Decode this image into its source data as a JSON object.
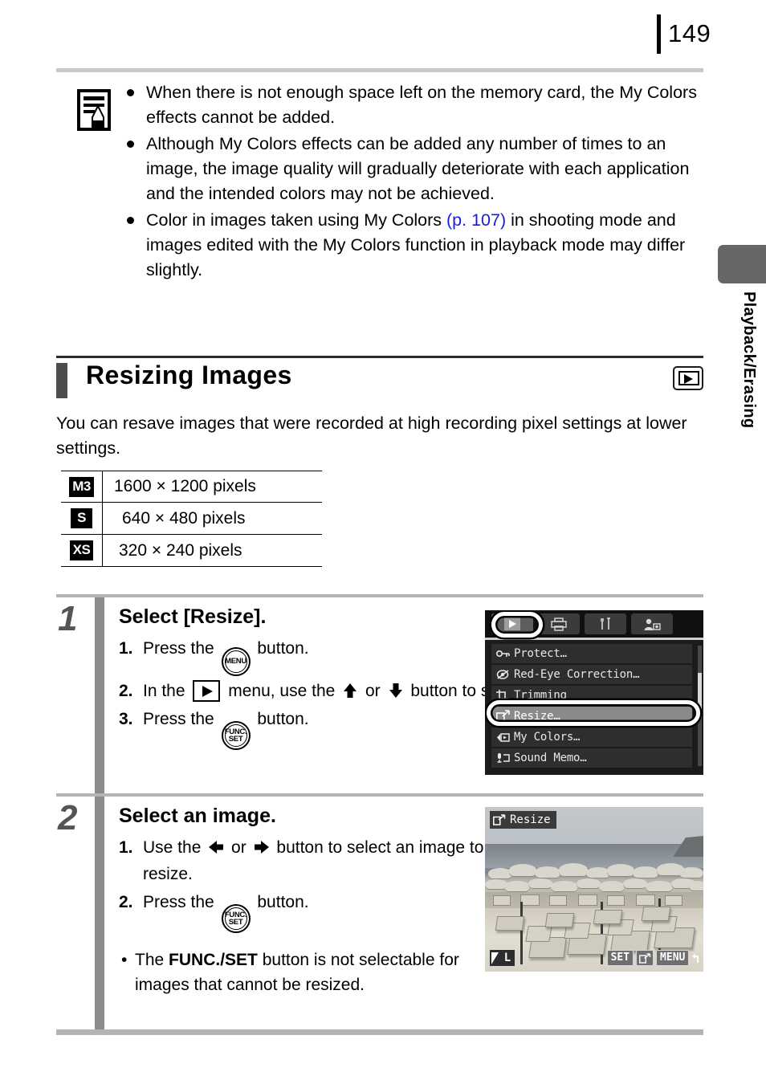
{
  "page": {
    "number": "149",
    "side_tab_label": "Playback/Erasing"
  },
  "note": {
    "icon": "memo-note-icon",
    "items": [
      {
        "text_before": "When there is not enough space left on the memory card, the My Colors effects cannot be added.",
        "xref": "",
        "text_after": ""
      },
      {
        "text_before": "Although My Colors effects can be added any number of times to an image, the image quality will gradually deteriorate with each application and the intended colors may not be achieved.",
        "xref": "",
        "text_after": ""
      },
      {
        "text_before": "Color in images taken using My Colors ",
        "xref": "(p. 107)",
        "text_after": " in shooting mode and images edited with the My Colors function in playback mode may differ slightly."
      }
    ],
    "xref_color": "#1a1ae0"
  },
  "section": {
    "title": "Resizing Images",
    "badge_icon": "playback-mode-icon",
    "description": "You can resave images that were recorded at high recording pixel settings at lower settings."
  },
  "size_table": {
    "rows": [
      {
        "badge": "M3",
        "label": "1600 × 1200 pixels"
      },
      {
        "badge": "S",
        "label": "640 × 480 pixels"
      },
      {
        "badge": "XS",
        "label": "320 × 240 pixels"
      }
    ]
  },
  "steps": [
    {
      "number": "1",
      "title": "Select [Resize].",
      "substeps": [
        {
          "num": "1.",
          "a": "Press the ",
          "icon": "menu-button-icon",
          "b": " button.",
          "c": "",
          "icon2": "",
          "d": ""
        },
        {
          "num": "2.",
          "a": "In the ",
          "icon": "playback-mode-icon",
          "b": " menu, use the ",
          "arrows": "up-down",
          "c": " button to select ",
          "icon2": "resize-icon",
          "d": "."
        },
        {
          "num": "3.",
          "a": "Press the ",
          "icon": "func-set-button-icon",
          "b": " button.",
          "c": "",
          "icon2": "",
          "d": ""
        }
      ],
      "notes": []
    },
    {
      "number": "2",
      "title": "Select an image.",
      "substeps": [
        {
          "num": "1.",
          "a": "Use the ",
          "arrows": "left-right",
          "b": " button to select an image to resize.",
          "c": "",
          "icon2": "",
          "d": ""
        },
        {
          "num": "2.",
          "a": "Press the ",
          "icon": "func-set-button-icon",
          "b": " button.",
          "c": "",
          "icon2": "",
          "d": ""
        }
      ],
      "notes": [
        {
          "a": "The ",
          "bold": "FUNC./SET",
          "b": " button is not selectable for images that cannot be resized."
        }
      ]
    }
  ],
  "camera_menu": {
    "tabs": [
      {
        "name": "playback-tab",
        "icon": "play-triangle-icon",
        "selected": true
      },
      {
        "name": "print-tab",
        "icon": "printer-icon",
        "selected": false
      },
      {
        "name": "settings-tab",
        "icon": "tools-icon",
        "selected": false
      },
      {
        "name": "my-camera-tab",
        "icon": "person-camera-icon",
        "selected": false
      }
    ],
    "items": [
      {
        "icon": "key-icon",
        "label": "Protect…",
        "selected": false
      },
      {
        "icon": "red-eye-icon",
        "label": "Red-Eye Correction…",
        "selected": false
      },
      {
        "icon": "trimming-icon",
        "label": "Trimming",
        "selected": false
      },
      {
        "icon": "resize-icon",
        "label": "Resize…",
        "selected": true
      },
      {
        "icon": "my-colors-icon",
        "label": "My Colors…",
        "selected": false
      },
      {
        "icon": "sound-memo-icon",
        "label": "Sound Memo…",
        "selected": false
      }
    ],
    "highlight_callouts": [
      "playback-tab",
      "resize-item"
    ]
  },
  "camera_photo": {
    "title_label": "Resize",
    "title_icon": "resize-icon",
    "quality_badge": "L",
    "bottom_keys": [
      {
        "type": "text",
        "label": "SET"
      },
      {
        "type": "icon",
        "label": "resize-icon"
      },
      {
        "type": "text",
        "label": "MENU"
      },
      {
        "type": "icon",
        "label": "return-arrow-icon"
      }
    ],
    "scene": "beach with sun loungers and parasols"
  },
  "colors": {
    "rail": "#8c8c8c",
    "step_number": "#555555",
    "heading_bar": "#4d4d4d",
    "side_tab": "#666666",
    "menu_selected": "#8a8a8a"
  }
}
